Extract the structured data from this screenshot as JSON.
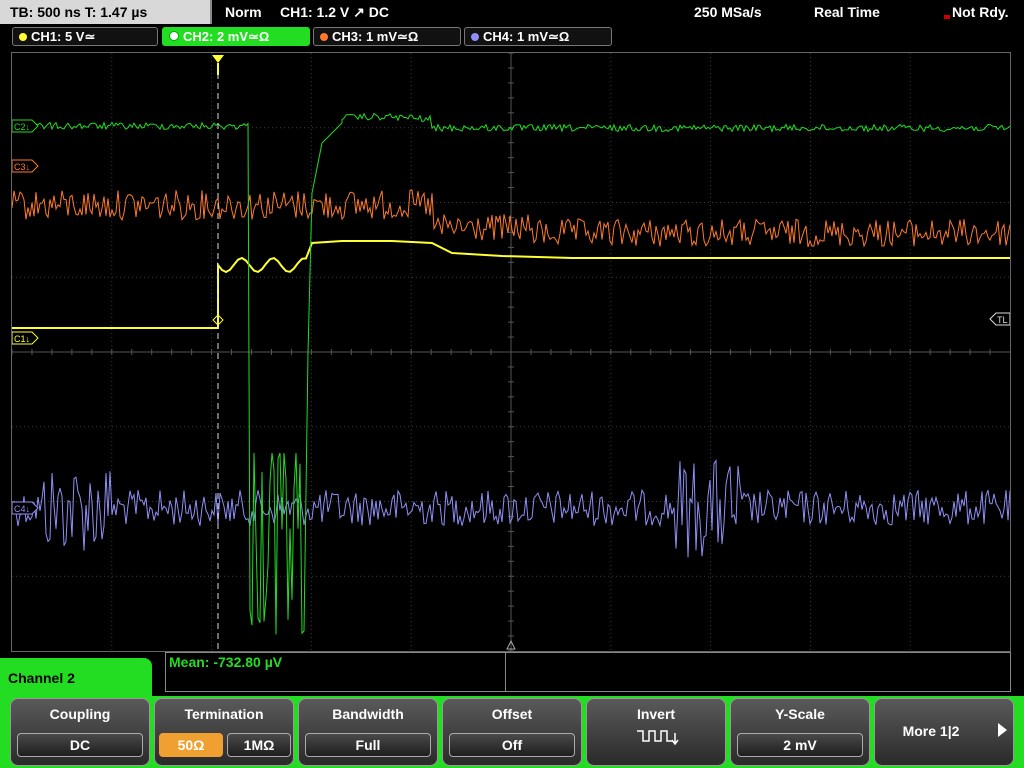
{
  "topbar": {
    "timebase": "TB: 500 ns   T: 1.47 µs",
    "mode": "Norm",
    "trigger": "CH1: 1.2 V ↗ DC",
    "samplerate": "250 MSa/s",
    "acq": "Real Time",
    "status": "Not Rdy."
  },
  "channels": [
    {
      "label": "CH1: 5 V≃",
      "color": "#ffff33"
    },
    {
      "label": "CH2: 2 mV≃Ω",
      "color": "#22dd22"
    },
    {
      "label": "CH3: 1 mV≃Ω",
      "color": "#ff7a2a"
    },
    {
      "label": "CH4: 1 mV≃Ω",
      "color": "#8f8ff5"
    }
  ],
  "markers": {
    "c1": "C1↓",
    "c2": "C2↓",
    "c3": "C3↓",
    "c4": "C4↓",
    "tl": "TL"
  },
  "measurement": {
    "label": "Mean: -732.80 µV"
  },
  "menu": {
    "title": "Channel 2",
    "softkeys": {
      "coupling": {
        "title": "Coupling",
        "value": "DC"
      },
      "termination": {
        "title": "Termination",
        "opt1": "50Ω",
        "opt2": "1MΩ"
      },
      "bandwidth": {
        "title": "Bandwidth",
        "value": "Full"
      },
      "offset": {
        "title": "Offset",
        "value": "Off"
      },
      "invert": {
        "title": "Invert",
        "icon": "invert-waveform-icon"
      },
      "yscale": {
        "title": "Y-Scale",
        "value": "2 mV"
      },
      "more": {
        "label": "More 1|2",
        "icon": "chevron-right-icon"
      }
    }
  },
  "colors": {
    "ch1": "#ffff33",
    "ch2": "#22dd22",
    "ch3": "#ff7a2a",
    "ch4": "#8f8ff5",
    "softbar": "#22dd22"
  }
}
